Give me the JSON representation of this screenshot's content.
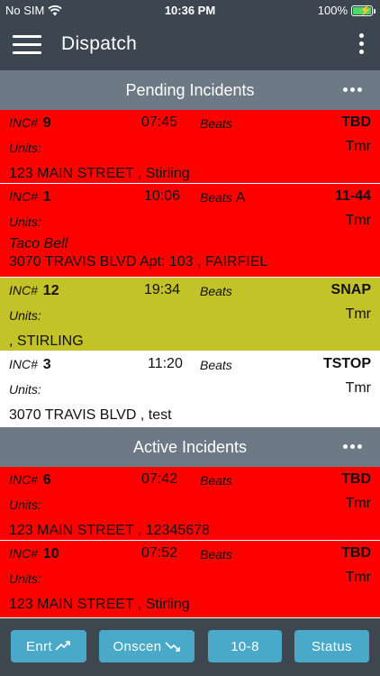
{
  "status_bar": {
    "carrier": "No SIM",
    "time": "10:36 PM",
    "battery": "100%",
    "battery_color": "#4cd964"
  },
  "nav": {
    "title": "Dispatch",
    "menu_icon": "hamburger-icon",
    "overflow_icon": "vertical-dots-icon"
  },
  "labels": {
    "inc_prefix": "INC#",
    "beats": "Beats",
    "units": "Units:"
  },
  "pending": {
    "title": "Pending Incidents",
    "incidents": [
      {
        "num": "9",
        "time": "07:45",
        "beat": "",
        "code": "TBD",
        "unit": "Tmr",
        "name": "",
        "address": "123 MAIN STREET , Stirling",
        "color": "#ff0000"
      },
      {
        "num": "1",
        "time": "10:06",
        "beat": "A",
        "code": "11-44",
        "unit": "Tmr",
        "name": "Taco Bell",
        "address": "3070 TRAVIS BLVD Apt: 103 , FAIRFIEL",
        "color": "#ff0000"
      },
      {
        "num": "12",
        "time": "19:34",
        "beat": "",
        "code": "SNAP",
        "unit": "Tmr",
        "name": "",
        "address": ", STIRLING",
        "color": "#c4c229"
      },
      {
        "num": "3",
        "time": "11:20",
        "beat": "",
        "code": "TSTOP",
        "unit": "Tmr",
        "name": "",
        "address": "3070 TRAVIS BLVD , test",
        "color": "#ffffff"
      }
    ]
  },
  "active": {
    "title": "Active Incidents",
    "incidents": [
      {
        "num": "6",
        "time": "07:42",
        "beat": "",
        "code": "TBD",
        "unit": "Tmr",
        "name": "",
        "address": "123 MAIN STREET , 12345678",
        "color": "#ff0000"
      },
      {
        "num": "10",
        "time": "07:52",
        "beat": "",
        "code": "TBD",
        "unit": "Tmr",
        "name": "",
        "address": "123 MAIN STREET , Stirling",
        "color": "#ff0000"
      }
    ]
  },
  "toolbar": {
    "enroute": "Enrt",
    "onscene": "Onscen",
    "available": "10-8",
    "status": "Status",
    "button_color": "#4aa9c9"
  }
}
